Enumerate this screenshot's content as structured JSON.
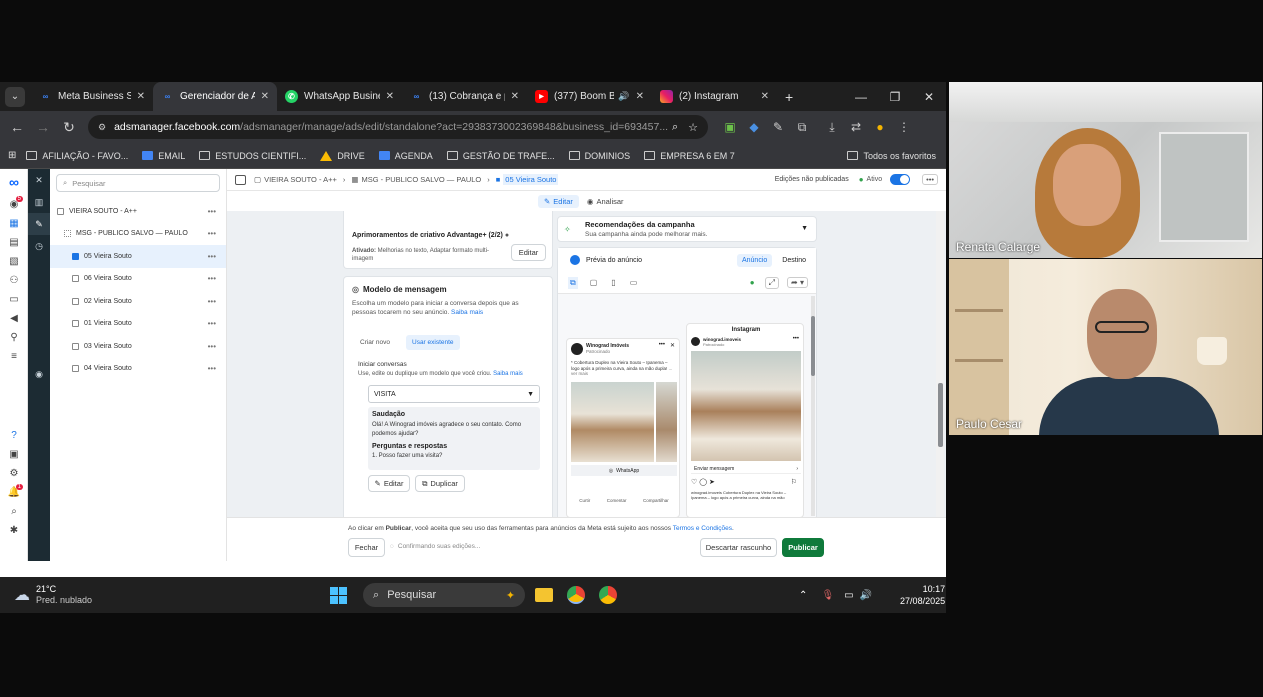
{
  "browser": {
    "tabs": [
      {
        "label": "Meta Business Sui",
        "icon": "meta-icon",
        "active": false
      },
      {
        "label": "Gerenciador de A",
        "icon": "meta-icon",
        "active": true
      },
      {
        "label": "WhatsApp Busine",
        "icon": "whatsapp-icon",
        "active": false
      },
      {
        "label": "(13) Cobrança e pa",
        "icon": "meta-icon",
        "active": false
      },
      {
        "label": "(377) Boom Ba",
        "icon": "youtube-icon",
        "active": false
      },
      {
        "label": "(2) Instagram",
        "icon": "instagram-icon",
        "active": false
      }
    ],
    "new_tab": "+",
    "url_domain": "adsmanager.facebook.com",
    "url_path": "/adsmanager/manage/ads/edit/standalone?act=2938373002369848&business_id=693457...",
    "bookmarks": [
      "AFILIAÇÃO - FAVO...",
      "EMAIL",
      "ESTUDOS CIENTIFI...",
      "DRIVE",
      "AGENDA",
      "GESTÃO DE TRAFE...",
      "DOMINIOS",
      "EMPRESA 6 EM 7"
    ],
    "all_bookmarks": "Todos os favoritos"
  },
  "sidebar": {
    "search_placeholder": "Pesquisar",
    "badge_count": "5",
    "notif_count": "1",
    "tree": [
      {
        "label": "VIEIRA SOUTO - A++",
        "level": 0
      },
      {
        "label": "MSG - PUBLICO SALVO — PAULO",
        "level": 1
      },
      {
        "label": "05 Vieira Souto",
        "level": 2,
        "selected": true
      },
      {
        "label": "06 Vieira Souto",
        "level": 2
      },
      {
        "label": "02 Vieira Souto",
        "level": 2
      },
      {
        "label": "01 Vieira Souto",
        "level": 2
      },
      {
        "label": "03 Vieira Souto",
        "level": 2
      },
      {
        "label": "04 Vieira Souto",
        "level": 2
      }
    ]
  },
  "breadcrumb": {
    "items": [
      "VIEIRA SOUTO - A++",
      "MSG - PUBLICO SALVO — PAULO",
      "05 Vieira Souto"
    ],
    "unpublished": "Edições não publicadas",
    "status": "Ativo"
  },
  "editbar": {
    "edit": "Editar",
    "analyze": "Analisar"
  },
  "left_panel": {
    "adv_title": "Aprimoramentos de criativo Advantage+ (2/2)",
    "adv_active_label": "Ativado:",
    "adv_active_text": "Melhorias no texto, Adaptar formato multi-imagem",
    "adv_edit": "Editar",
    "msg_title": "Modelo de mensagem",
    "msg_desc": "Escolha um modelo para iniciar a conversa depois que as pessoas tocarem no seu anúncio.",
    "msg_learn": "Saiba mais",
    "tab_new": "Criar novo",
    "tab_existing": "Usar existente",
    "start_title": "Iniciar conversas",
    "start_desc": "Use, edite ou duplique um modelo que você criou.",
    "start_learn": "Saiba mais",
    "select_value": "VISITA",
    "greeting_title": "Saudação",
    "greeting_text": "Olá! A Winograd imóveis agradece o seu contato. Como podemos ajudar?",
    "qa_title": "Perguntas e respostas",
    "qa_text": "1. Posso fazer uma visita?",
    "btn_edit": "Editar",
    "btn_duplicate": "Duplicar"
  },
  "right_panel": {
    "rec_title": "Recomendações da campanha",
    "rec_sub": "Sua campanha ainda pode melhorar mais.",
    "preview_label": "Prévia do anúncio",
    "tab_ad": "Anúncio",
    "tab_dest": "Destino",
    "post1_name": "Winograd Imóveis",
    "post1_sub": "Patrocinado",
    "post1_caption": "* Cobertura Duplex na Vieira Souto – Ipanema – logo após a primeira curva, ainda na mão dupla!",
    "post1_more": "... ver mais",
    "post1_cta": "WhatsApp",
    "post1_actions": [
      "Curtir",
      "Comentar",
      "Compartilhar"
    ],
    "post2_header": "Instagram",
    "post2_name": "winograd.imoveis",
    "post2_sub": "Patrocinado",
    "post2_cta": "Enviar mensagem",
    "post2_caption": "winograd.imoveis Cobertura Duplex na Vieira Souto – Ipanema – logo após a primeira curva, ainda na mão"
  },
  "footer": {
    "notice_pre": "Ao clicar em",
    "notice_bold": "Publicar",
    "notice_mid": ", você aceita que seu uso das ferramentas para anúncios da Meta está sujeito aos nossos",
    "notice_link": "Termos e Condições",
    "close": "Fechar",
    "saving": "Confirmando suas edições...",
    "discard": "Descartar rascunho",
    "publish": "Publicar"
  },
  "taskbar": {
    "temp": "21°C",
    "weather": "Pred. nublado",
    "search": "Pesquisar",
    "time": "10:17",
    "date": "27/08/2025"
  },
  "participants": [
    {
      "name": "Renata Calarge"
    },
    {
      "name": "Paulo Cesar"
    }
  ],
  "colors": {
    "accent": "#1b74e4",
    "publish": "#0f7a3b",
    "meta_dark": "#1c2b33"
  }
}
